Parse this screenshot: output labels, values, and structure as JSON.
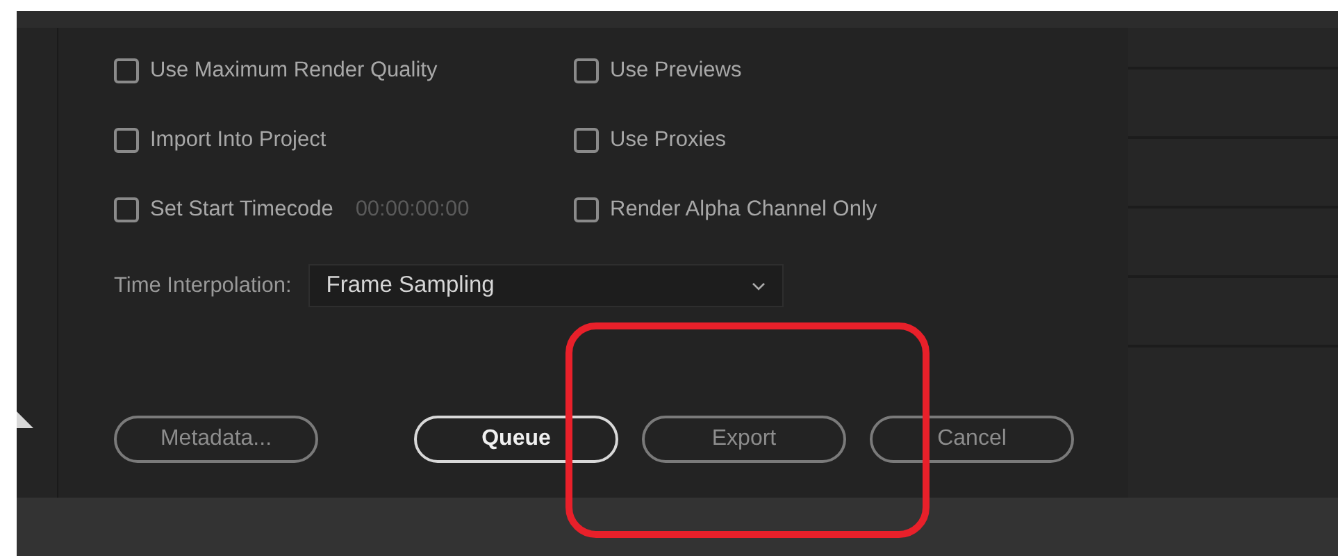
{
  "options": [
    {
      "label": "Use Maximum Render Quality",
      "checked": false
    },
    {
      "label": "Use Previews",
      "checked": false
    },
    {
      "label": "Import Into Project",
      "checked": false
    },
    {
      "label": "Use Proxies",
      "checked": false
    },
    {
      "label": "Set Start Timecode",
      "checked": false,
      "value": "00:00:00:00"
    },
    {
      "label": "Render Alpha Channel Only",
      "checked": false
    }
  ],
  "time_interpolation": {
    "label": "Time Interpolation:",
    "value": "Frame Sampling"
  },
  "buttons": [
    {
      "label": "Metadata...",
      "default": false
    },
    {
      "label": "Queue",
      "default": true
    },
    {
      "label": "Export",
      "default": false
    },
    {
      "label": "Cancel",
      "default": false
    }
  ]
}
